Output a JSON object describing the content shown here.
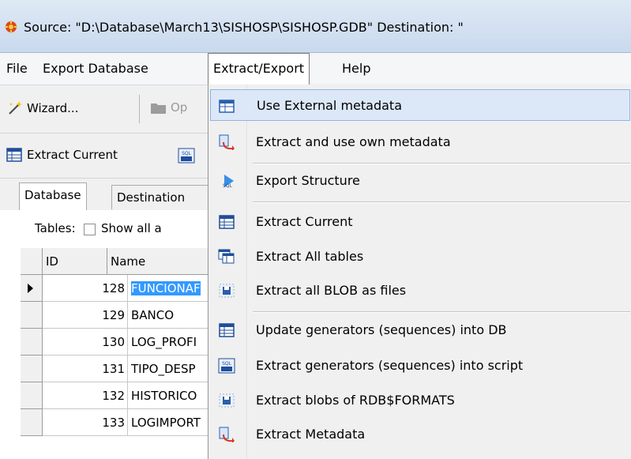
{
  "window": {
    "title": "Source: \"D:\\Database\\March13\\SISHOSP\\SISHOSP.GDB\" Destination: \""
  },
  "menubar": {
    "items": [
      "File",
      "Export Database",
      "Extract/Export",
      "Help"
    ],
    "active": "Extract/Export"
  },
  "toolbar": {
    "wizard_label": "Wizard...",
    "open_label": "Op",
    "extract_current_label": "Extract Current"
  },
  "tabs": [
    "Database",
    "Destination"
  ],
  "tables_row": {
    "label": "Tables:",
    "checkbox_label": "Show all a"
  },
  "grid": {
    "columns": [
      "ID",
      "Name"
    ],
    "rows": [
      {
        "id": "128",
        "name": "FUNCIONAF",
        "selected": true
      },
      {
        "id": "129",
        "name": "BANCO",
        "selected": false
      },
      {
        "id": "130",
        "name": "LOG_PROFI",
        "selected": false
      },
      {
        "id": "131",
        "name": "TIPO_DESP",
        "selected": false
      },
      {
        "id": "132",
        "name": "HISTORICO",
        "selected": false
      },
      {
        "id": "133",
        "name": "LOGIMPORT",
        "selected": false
      }
    ]
  },
  "dropdown": {
    "items": [
      {
        "label": "Use External metadata",
        "icon": "external-metadata-icon",
        "highlighted": true
      },
      {
        "label": "Extract and use own metadata",
        "icon": "own-metadata-icon"
      },
      {
        "label": "Export Structure",
        "icon": "export-structure-icon"
      },
      {
        "label": "Extract Current",
        "icon": "extract-current-icon"
      },
      {
        "label": "Extract All tables",
        "icon": "extract-all-tables-icon"
      },
      {
        "label": "Extract all BLOB as files",
        "icon": "blob-files-icon"
      },
      {
        "label": "Update generators (sequences) into DB",
        "icon": "update-generators-icon"
      },
      {
        "label": "Extract generators (sequences) into script",
        "icon": "sql-script-icon"
      },
      {
        "label": "Extract blobs of RDB$FORMATS",
        "icon": "blob-formats-icon"
      },
      {
        "label": "Extract Metadata",
        "icon": "extract-metadata-icon"
      }
    ]
  },
  "colors": {
    "selection": "#3399ff",
    "menu_highlight": "#dce8f8",
    "menu_highlight_border": "#91b4e3"
  }
}
